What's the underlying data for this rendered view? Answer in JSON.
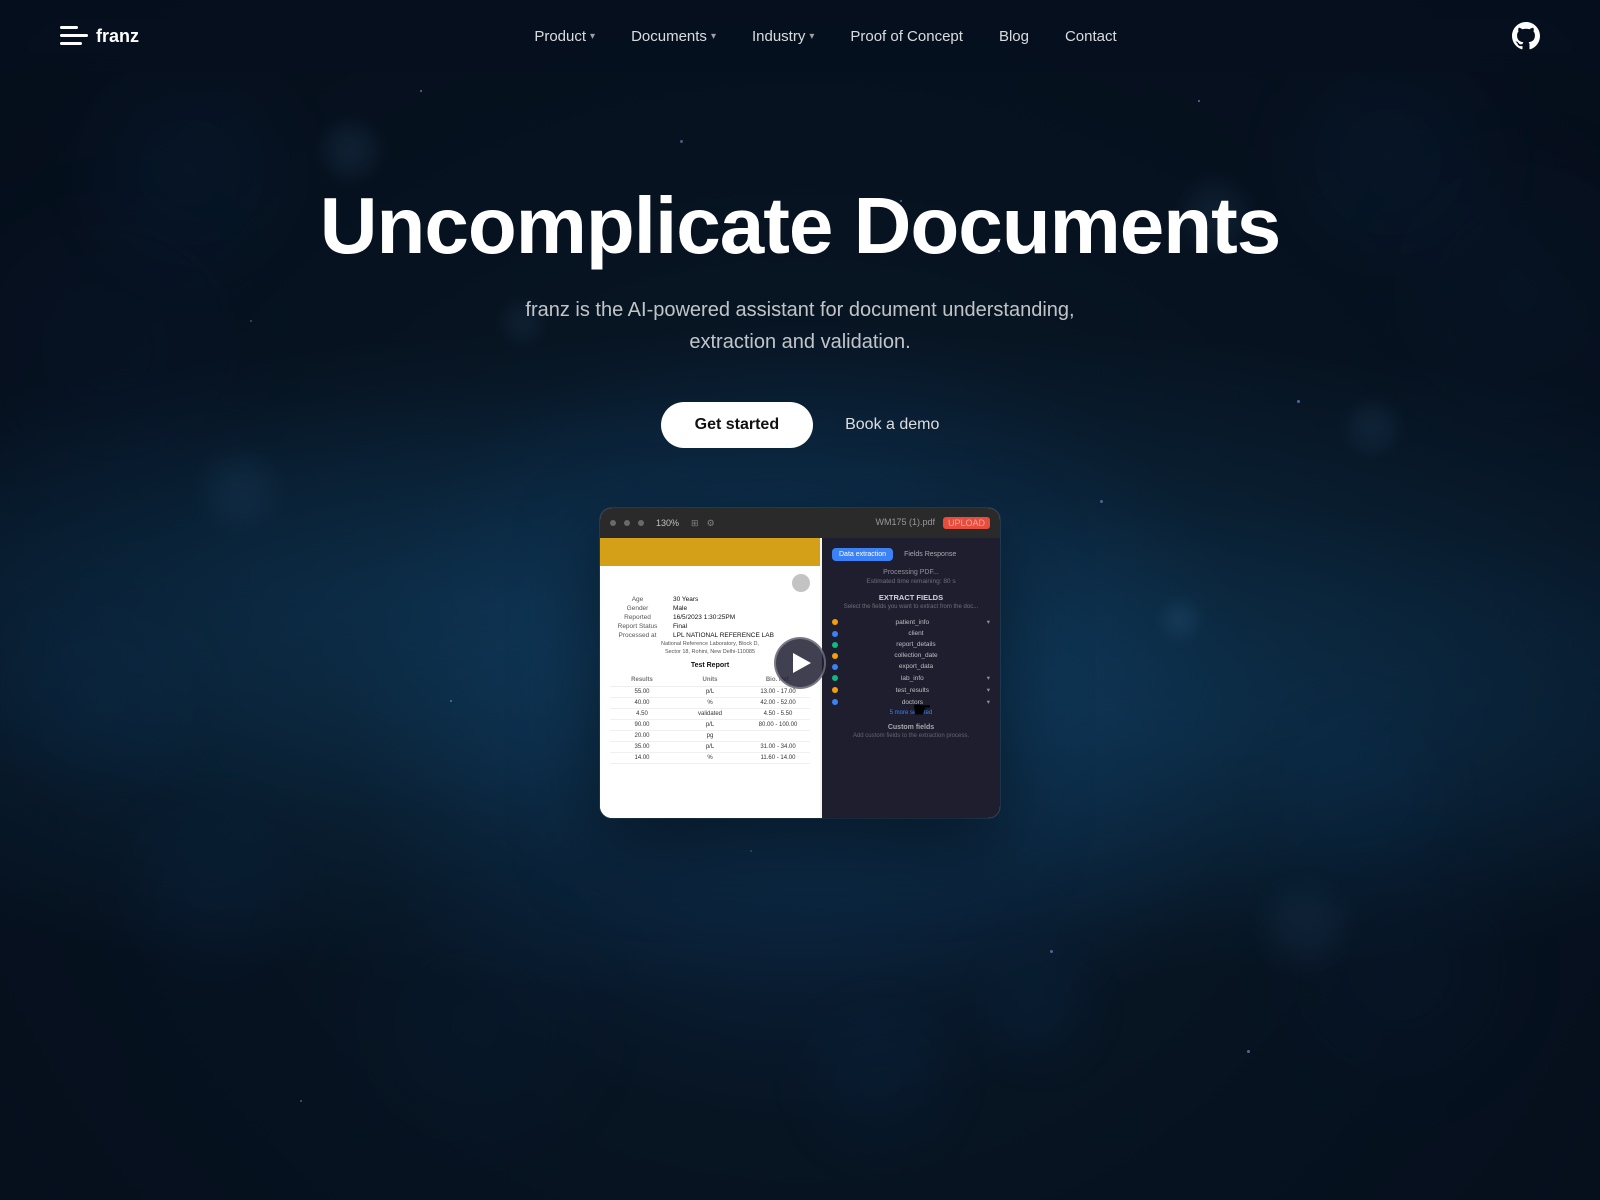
{
  "brand": {
    "name": "franz",
    "logo_alt": "franz logo"
  },
  "nav": {
    "links": [
      {
        "id": "product",
        "label": "Product",
        "has_dropdown": true
      },
      {
        "id": "documents",
        "label": "Documents",
        "has_dropdown": true
      },
      {
        "id": "industry",
        "label": "Industry",
        "has_dropdown": true
      },
      {
        "id": "proof-of-concept",
        "label": "Proof of Concept",
        "has_dropdown": false
      },
      {
        "id": "blog",
        "label": "Blog",
        "has_dropdown": false
      },
      {
        "id": "contact",
        "label": "Contact",
        "has_dropdown": false
      }
    ]
  },
  "hero": {
    "title": "Uncomplicate Documents",
    "subtitle": "franz is the AI-powered assistant for document understanding, extraction and validation.",
    "cta_primary": "Get started",
    "cta_secondary": "Book a demo"
  },
  "preview": {
    "toolbar": {
      "zoom": "130%",
      "filename": "WM175 (1).pdf",
      "badge": "UPLOAD"
    },
    "doc": {
      "fields": [
        {
          "label": "Age",
          "value": "30 Years"
        },
        {
          "label": "Gender",
          "value": "Male"
        },
        {
          "label": "Reported",
          "value": "16/5/2023 1:30:25PM"
        },
        {
          "label": "Report Status",
          "value": "Final"
        },
        {
          "label": "Processed at",
          "value": "LPL NATIONAL REFERENCE LAB"
        }
      ],
      "address": "National Reference Laboratory, Block D, Sector 18, Rohini, New Delhi-110085",
      "section": "Test Report",
      "table_headers": [
        "Results",
        "Units",
        "Bio. Ref."
      ],
      "table_rows": [
        [
          "55.00",
          "p/L",
          "13.00 - 17.00"
        ],
        [
          "40.00",
          "%",
          "42.00 - 52.00"
        ],
        [
          "4.50",
          "validated",
          "4.50 - 5.50"
        ],
        [
          "90.00",
          "p/L",
          "80.00 - 100.00"
        ],
        [
          "20.00",
          "pg",
          ""
        ],
        [
          "35.00",
          "p/L",
          "31.00 - 34.00"
        ],
        [
          "14.00",
          "%",
          "11.60 - 14.00"
        ]
      ]
    },
    "extraction": {
      "tabs": [
        "Data extraction",
        "Fields Response"
      ],
      "status": "Processing PDF...",
      "time": "Estimated time remaining: 80 s",
      "section_title": "EXTRACT FIELDS",
      "section_sub": "Select the fields you want to extract from the doc...",
      "fields": [
        {
          "color": "#f59e0b",
          "name": "patient_info",
          "has_dropdown": true
        },
        {
          "color": "#3b82f6",
          "name": "client",
          "has_dropdown": false
        },
        {
          "color": "#10b981",
          "name": "report_details",
          "has_dropdown": false
        },
        {
          "color": "#f59e0b",
          "name": "collection_date",
          "has_dropdown": false
        },
        {
          "color": "#3b82f6",
          "name": "export_data",
          "has_dropdown": false
        },
        {
          "color": "#10b981",
          "name": "lab_info",
          "has_dropdown": true
        },
        {
          "color": "#f59e0b",
          "name": "test_results",
          "has_dropdown": true
        },
        {
          "color": "#3b82f6",
          "name": "doctors",
          "has_dropdown": true
        }
      ],
      "more_selected": "5 more selected",
      "custom_fields_title": "Custom fields",
      "custom_fields_sub": "Add custom fields to the extraction process."
    }
  }
}
